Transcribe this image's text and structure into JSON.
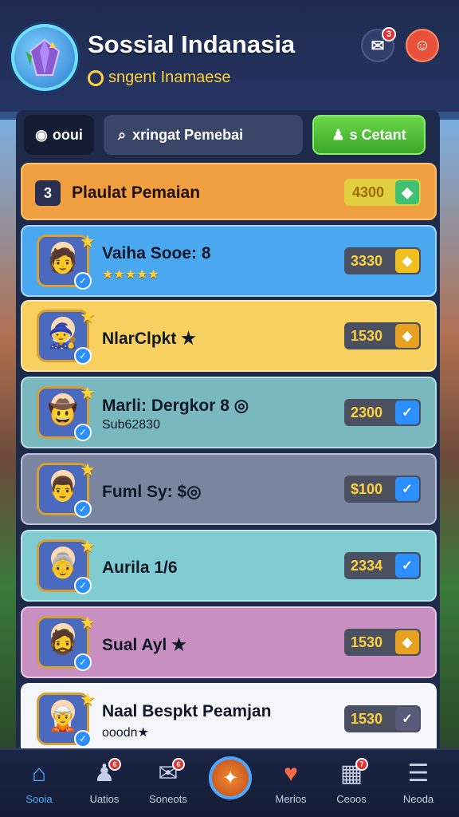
{
  "header": {
    "title": "Sossial Indanasia",
    "subtitle": "sngent Inamaese",
    "chat_badge": "3"
  },
  "toolbar": {
    "filter_label": "ooui",
    "search_placeholder": "xringat Pemebai",
    "action_label": "s Cetant"
  },
  "leaderboard": {
    "header_row": {
      "rank": "3",
      "title": "Plaulat Pemaian",
      "score": "4300"
    },
    "players": [
      {
        "name": "Vaiha Sooe: 8",
        "sub": "★★★★★",
        "score": "3330",
        "bg": "#4aa8f0",
        "tag_color": "#f0c020",
        "tag_icon": "diamond-icon"
      },
      {
        "name": "NlarClpkt ★",
        "sub": "",
        "score": "1530",
        "bg": "#f8d060",
        "tag_color": "#e8a020",
        "tag_icon": "diamond-icon"
      },
      {
        "name": "Marli: Dergkor 8 ◎",
        "sub": "Sub62830",
        "score": "2300",
        "bg": "#7ab8c0",
        "tag_color": "#2b8fff",
        "tag_icon": "check-icon"
      },
      {
        "name": "Fuml Sy: $◎",
        "sub": "",
        "score": "$100",
        "bg": "#7a86a0",
        "tag_color": "#2b8fff",
        "tag_icon": "check-icon"
      },
      {
        "name": "Aurila 1/6",
        "sub": "",
        "score": "2334",
        "bg": "#80ccd0",
        "tag_color": "#2b8fff",
        "tag_icon": "check-icon"
      },
      {
        "name": "Sual Ayl ★",
        "sub": "",
        "score": "1530",
        "bg": "#c890c0",
        "tag_color": "#e8a020",
        "tag_icon": "diamond-icon"
      },
      {
        "name": "Naal Bespkt Peamjan",
        "sub": "ooodn★",
        "score": "1530",
        "bg": "#f4f6fa",
        "tag_color": "#5a5a7a",
        "tag_icon": "check-icon"
      }
    ]
  },
  "nav": {
    "items": [
      {
        "label": "Sooia",
        "icon": "home-icon",
        "badge": ""
      },
      {
        "label": "Uatios",
        "icon": "people-icon",
        "badge": "6"
      },
      {
        "label": "Soneots",
        "icon": "chat-icon",
        "badge": "6"
      },
      {
        "label": "Merios",
        "icon": "heart-icon",
        "badge": ""
      },
      {
        "label": "Ceoos",
        "icon": "grid-icon",
        "badge": "7"
      },
      {
        "label": "Neoda",
        "icon": "list-icon",
        "badge": ""
      }
    ]
  },
  "colors": {
    "accent_green": "#4ac830",
    "accent_gold": "#ffd23a",
    "header_row_bg": "#f0a040"
  }
}
